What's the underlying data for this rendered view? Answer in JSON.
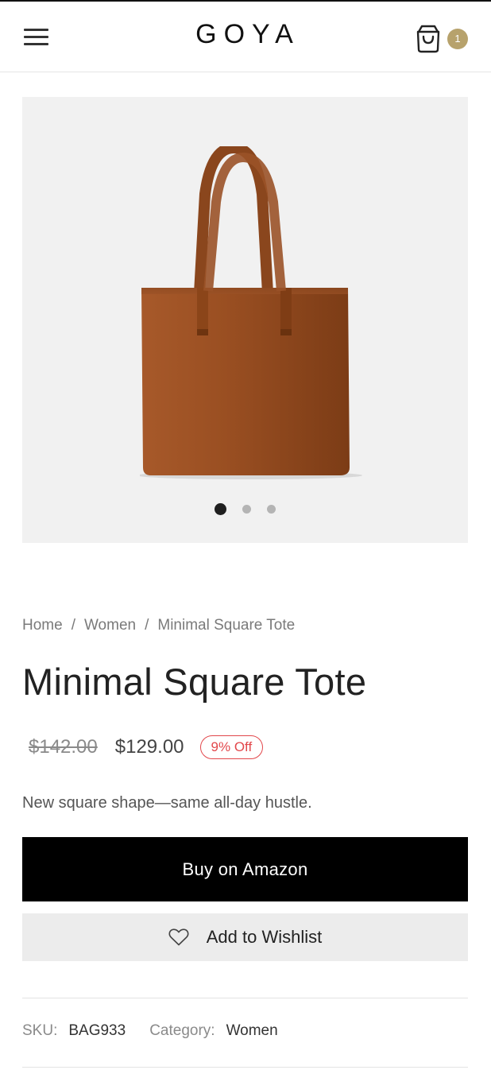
{
  "header": {
    "logo": "GOYA",
    "menu_icon": "hamburger-menu-icon",
    "cart_icon": "shopping-bag-icon",
    "cart_count": "1",
    "badge_color": "#b7a26c"
  },
  "gallery": {
    "image": "brown leather tote bag",
    "slide_count": 3,
    "active_slide": 1
  },
  "breadcrumb": {
    "items": [
      "Home",
      "Women",
      "Minimal Square Tote"
    ],
    "separator": "/"
  },
  "product": {
    "title": "Minimal Square Tote",
    "old_price": "$142.00",
    "price": "$129.00",
    "discount": "9% Off",
    "discount_color": "#e2474b",
    "description": "New square shape—same all-day hustle.",
    "buy_label": "Buy on Amazon",
    "wishlist_label": "Add to Wishlist",
    "wishlist_icon": "heart-icon"
  },
  "meta": {
    "sku_label": "SKU:",
    "sku_value": "BAG933",
    "category_label": "Category:",
    "category_value": "Women"
  }
}
